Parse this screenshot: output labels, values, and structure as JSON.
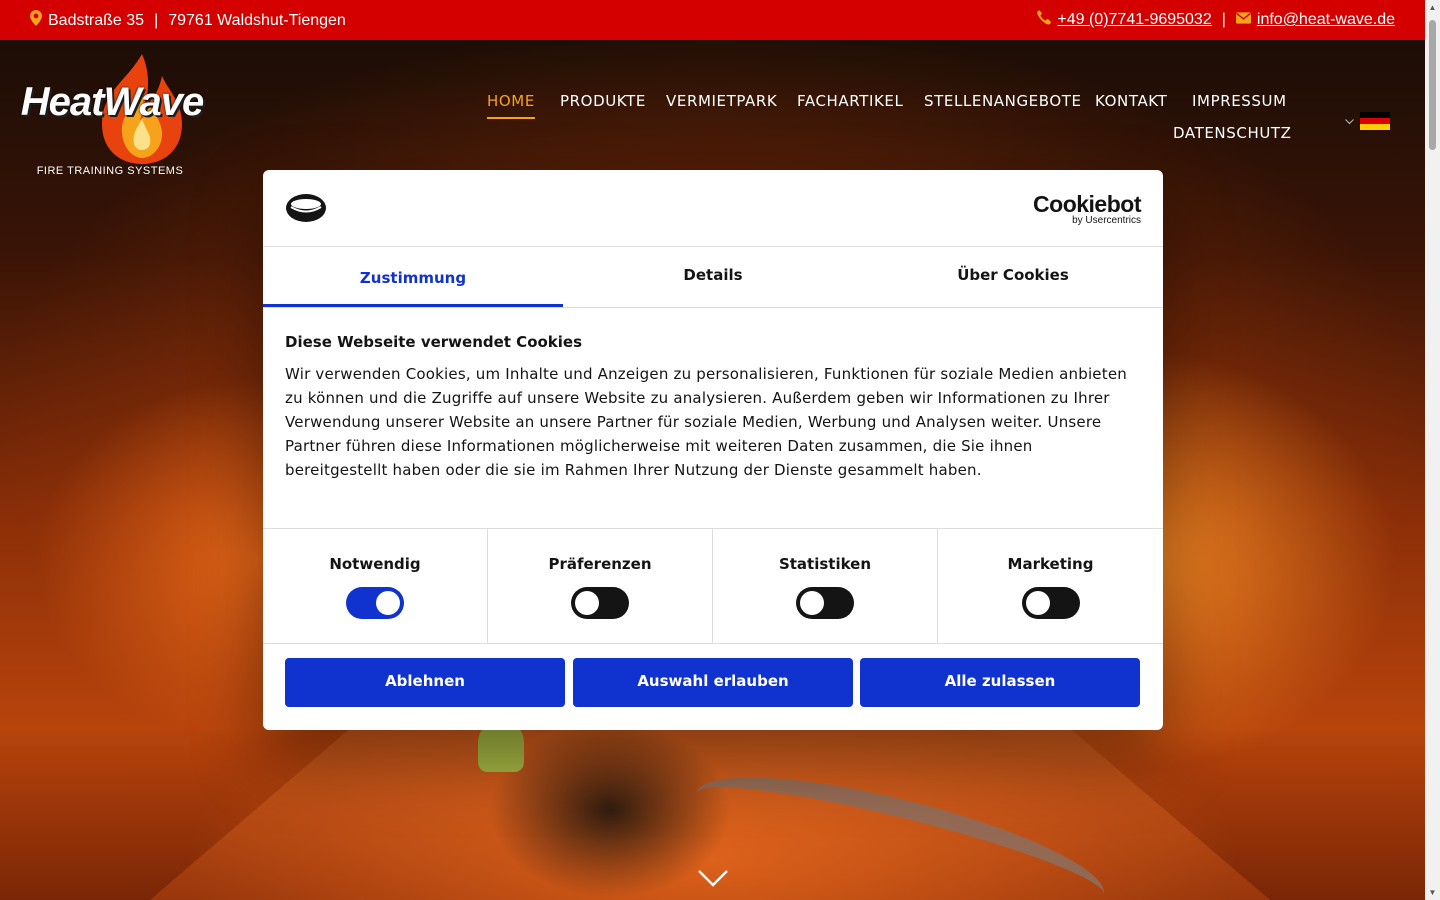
{
  "topbar": {
    "address_street": "Badstraße 35",
    "address_separator": "|",
    "address_city": "79761 Waldshut-Tiengen",
    "phone": "+49 (0)7741-9695032",
    "contact_separator": "|",
    "email": "info@heat-wave.de",
    "background": "#d40000"
  },
  "logo": {
    "name": "HeatWave",
    "tagline": "FIRE TRAINING SYSTEMS"
  },
  "nav": {
    "items": [
      {
        "label": "HOME",
        "active": true
      },
      {
        "label": "PRODUKTE"
      },
      {
        "label": "VERMIETPARK"
      },
      {
        "label": "FACHARTIKEL"
      },
      {
        "label": "STELLENANGEBOTE"
      },
      {
        "label": "KONTAKT"
      },
      {
        "label": "IMPRESSUM"
      },
      {
        "label": "DATENSCHUTZ"
      }
    ],
    "accent": "#f7a21b",
    "language_flag": "german-flag-icon"
  },
  "cookie_dialog": {
    "brand_name": "Cookiebot",
    "brand_sub": "by Usercentrics",
    "tabs": [
      "Zustimmung",
      "Details",
      "Über Cookies"
    ],
    "active_tab": "Zustimmung",
    "title": "Diese Webseite verwendet Cookies",
    "text": "Wir verwenden Cookies, um Inhalte und Anzeigen zu personalisieren, Funktionen für soziale Medien anbieten zu können und die Zugriffe auf unsere Website zu analysieren. Außerdem geben wir Informationen zu Ihrer Verwendung unserer Website an unsere Partner für soziale Medien, Werbung und Analysen weiter. Unsere Partner führen diese Informationen möglicherweise mit weiteren Daten zusammen, die Sie ihnen bereitgestellt haben oder die sie im Rahmen Ihrer Nutzung der Dienste gesammelt haben.",
    "toggles": [
      {
        "label": "Notwendig",
        "on": true
      },
      {
        "label": "Präferenzen",
        "on": false
      },
      {
        "label": "Statistiken",
        "on": false
      },
      {
        "label": "Marketing",
        "on": false
      }
    ],
    "buttons": {
      "decline": "Ablehnen",
      "allow_selection": "Auswahl erlauben",
      "allow_all": "Alle zulassen"
    },
    "accent": "#1032cf"
  }
}
